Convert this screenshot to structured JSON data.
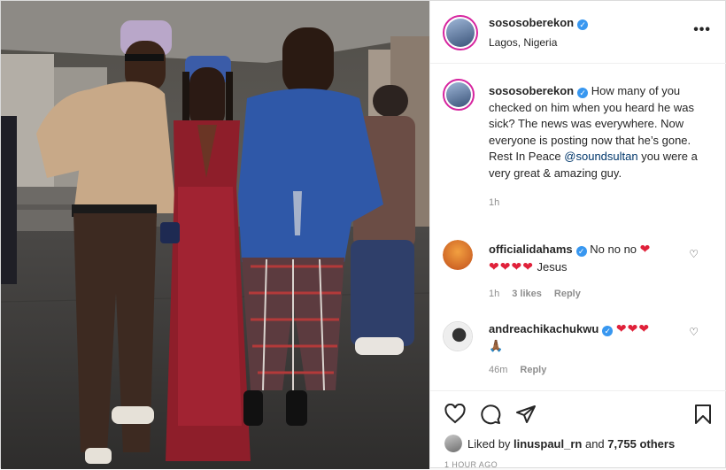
{
  "header": {
    "username": "sososoberekon",
    "location": "Lagos, Nigeria",
    "more_icon": "more-horizontal-icon"
  },
  "caption": {
    "username": "sososoberekon",
    "text_before": "How many of you checked on him when you heard he was sick? The news was everywhere. Now everyone is posting now that he’s gone. Rest In Peace",
    "mention": "@soundsultan",
    "text_after": "you were a very great & amazing guy.",
    "time": "1h"
  },
  "comments": [
    {
      "username": "officialidahams",
      "text": "No no no",
      "hearts_inline": "❤",
      "hearts_line2": "❤❤❤❤",
      "text_line2": "Jesus",
      "time": "1h",
      "likes": "3 likes",
      "reply": "Reply"
    },
    {
      "username": "andreachikachukwu",
      "text": "❤❤❤",
      "line2": "🙏🏾",
      "time": "46m",
      "reply": "Reply"
    }
  ],
  "actions": {
    "like_icon": "heart-icon",
    "comment_icon": "comment-icon",
    "share_icon": "share-icon",
    "save_icon": "bookmark-icon"
  },
  "likes": {
    "prefix": "Liked by",
    "user": "linuspaul_rn",
    "middle": "and",
    "count": "7,755 others"
  },
  "posted": "1 HOUR AGO",
  "colors": {
    "verified": "#3897f0",
    "mention": "#00376b",
    "heart": "#e0213a",
    "muted": "#8e8e8e"
  }
}
